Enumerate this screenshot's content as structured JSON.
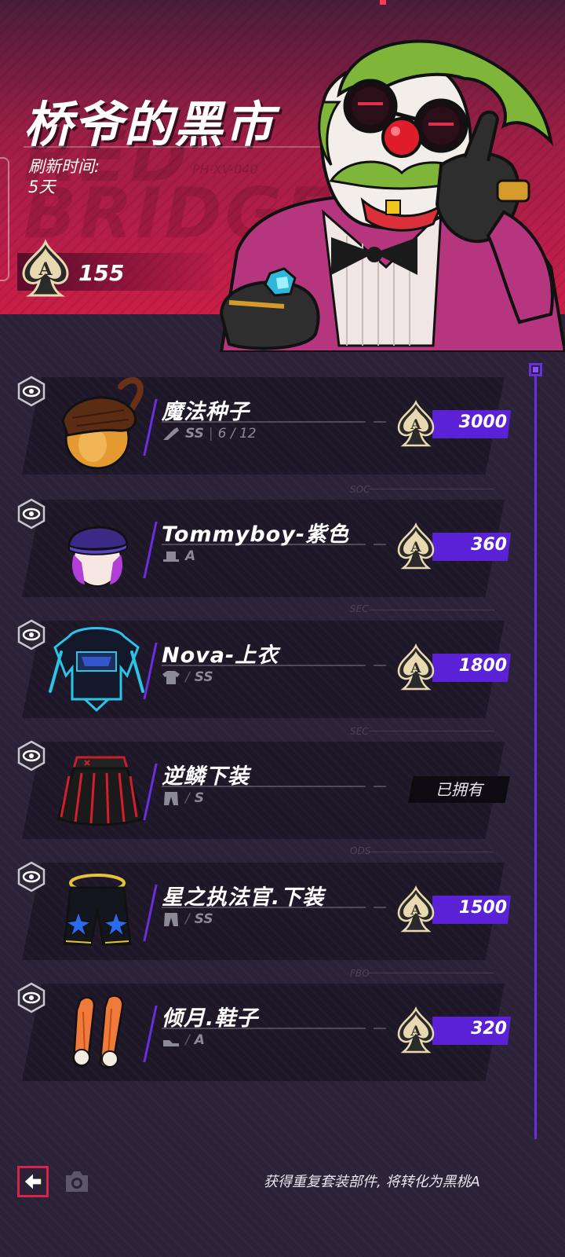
{
  "header": {
    "title": "桥爷的黑市",
    "refresh_label": "刷新时间:",
    "refresh_value": "5天",
    "bg_text_top": "RED",
    "bg_text_bottom": "BRIDGE",
    "bg_code": "PH-XV-040",
    "currency_amount": "155",
    "currency_icon": "spade-ace-icon"
  },
  "colors": {
    "header_red": "#c81e48",
    "price_purple": "#5b21d6",
    "background": "#2b2237",
    "card": "#1d1727"
  },
  "items": [
    {
      "name": "魔法种子",
      "meta_icon": "weapon-icon",
      "grade": "SS",
      "count_text": "6 / 12",
      "price": "3000",
      "owned": false
    },
    {
      "name": "Tommyboy-紫色",
      "meta_icon": "hat-icon",
      "grade": "A",
      "price": "360",
      "owned": false
    },
    {
      "name": "Nova-上衣",
      "meta_icon": "shirt-icon",
      "grade": "SS",
      "price": "1800",
      "owned": false
    },
    {
      "name": "逆鳞下装",
      "meta_icon": "pants-icon",
      "grade": "S",
      "owned": true,
      "owned_label": "已拥有"
    },
    {
      "name": "星之执法官.下装",
      "meta_icon": "pants-icon",
      "grade": "SS",
      "price": "1500",
      "owned": false
    },
    {
      "name": "倾月.鞋子",
      "meta_icon": "shoe-icon",
      "grade": "A",
      "price": "320",
      "owned": false
    }
  ],
  "footer": {
    "note": "获得重复套装部件, 将转化为黑桃A"
  }
}
